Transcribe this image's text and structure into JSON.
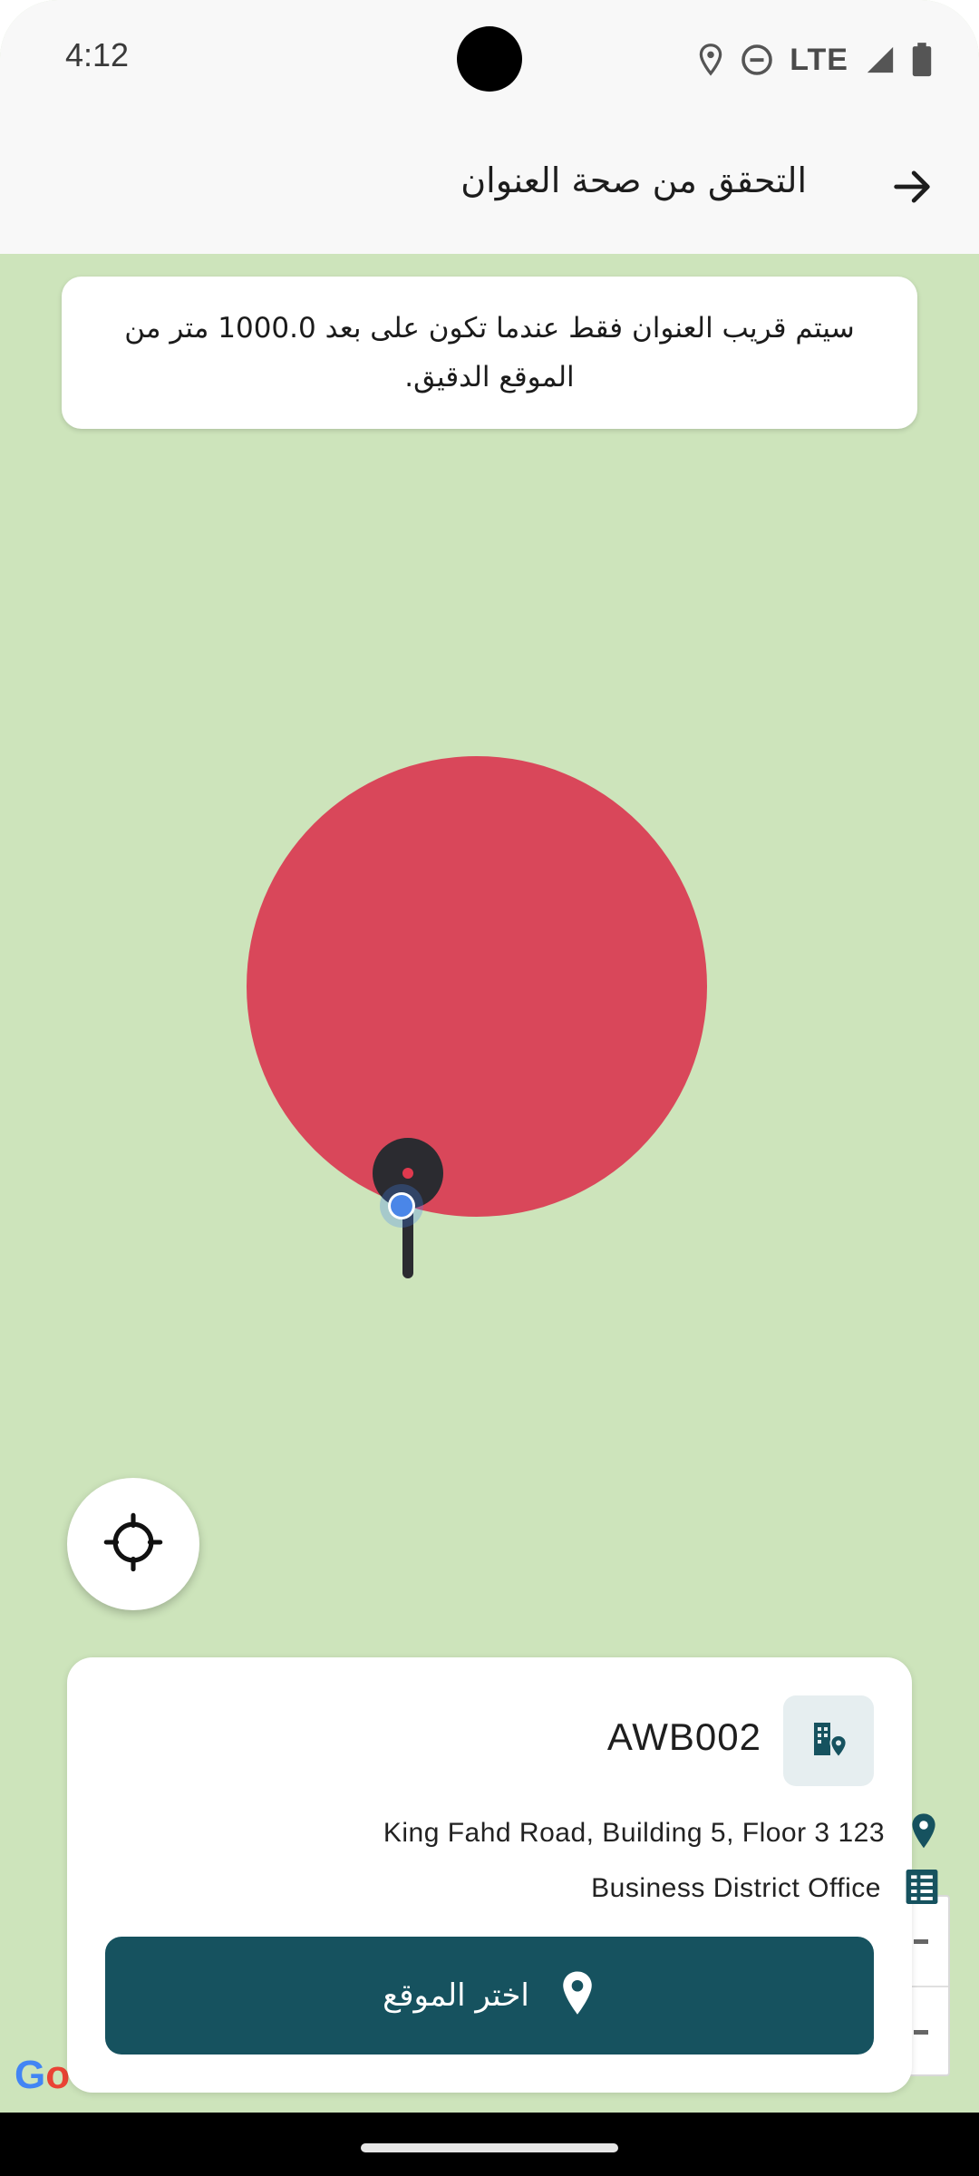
{
  "status_bar": {
    "time": "4:12",
    "network": "LTE"
  },
  "app_bar": {
    "title": "التحقق من صحة العنوان",
    "back_icon": "arrow-right-icon"
  },
  "notice": {
    "text": "سيتم قريب العنوان فقط عندما تكون على بعد 1000.0 متر من الموقع الدقيق."
  },
  "map": {
    "radius_color": "#d9475a",
    "background_color": "#cde4bb",
    "locate_icon": "crosshair-icon",
    "google_logo": "Go"
  },
  "card": {
    "awb": "AWB002",
    "address": "King Fahd Road, Building 5, Floor 3 123",
    "office": "Business District Office",
    "select_button_label": "اختر الموقع",
    "accent_color": "#16525f"
  }
}
